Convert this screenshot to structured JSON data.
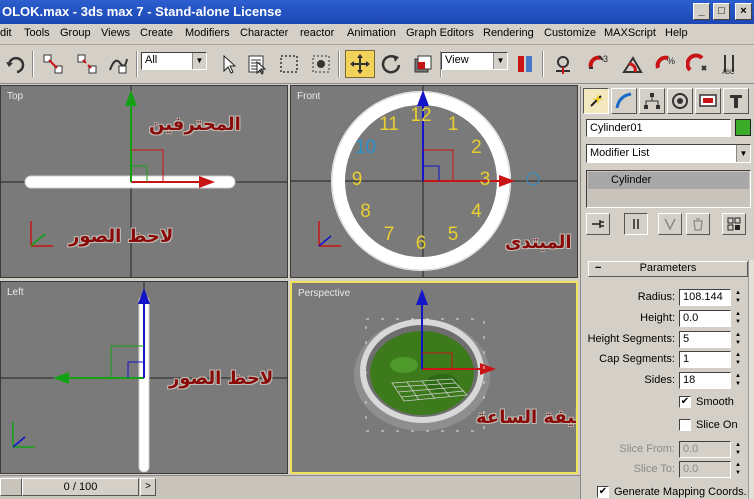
{
  "window": {
    "title": "OLOK.max - 3ds max 7  - Stand-alone License",
    "min": "_",
    "max": "□",
    "close": "×"
  },
  "menu": [
    "dit",
    "Tools",
    "Group",
    "Views",
    "Create",
    "Modifiers",
    "Character",
    "reactor",
    "Animation",
    "Graph Editors",
    "Rendering",
    "Customize",
    "MAXScript",
    "Help"
  ],
  "toolbar": {
    "selection_filter": "All",
    "reference_coord": "View",
    "icons": [
      "undo-icon",
      "select-link-icon",
      "unlink-icon",
      "bind-space-warp-icon",
      "select-object-icon",
      "select-by-name-icon",
      "rect-selection-icon",
      "window-crossing-icon",
      "select-move-icon",
      "select-rotate-icon",
      "select-scale-icon",
      "use-pivot-icon",
      "select-manipulate-icon",
      "snap-3d-icon",
      "angle-snap-icon",
      "percent-snap-icon",
      "spinner-snap-icon",
      "named-selection-icon"
    ]
  },
  "viewports": {
    "top": {
      "label": "Top",
      "note": "المحترفين",
      "note2": "لاحظ الصور"
    },
    "front": {
      "label": "Front",
      "note": "المبتدى",
      "clock_numbers": [
        "12",
        "1",
        "2",
        "3",
        "4",
        "5",
        "6",
        "7",
        "8",
        "9",
        "10",
        "11"
      ]
    },
    "left": {
      "label": "Left",
      "note": "لاحظ الصور"
    },
    "perspective": {
      "label": "Perspective",
      "note": "هذه مقاسات الخليفة الساعة"
    }
  },
  "command_panel": {
    "object_name": "Cylinder01",
    "object_color": "#3cab2a",
    "modifier_list": "Modifier List",
    "stack_item": "Cylinder",
    "rollout_title": "Parameters",
    "rollout_toggle": "−",
    "params": [
      {
        "label": "Radius:",
        "value": "108.144",
        "enabled": true
      },
      {
        "label": "Height:",
        "value": "0.0",
        "enabled": true
      },
      {
        "label": "Height Segments:",
        "value": "5",
        "enabled": true
      },
      {
        "label": "Cap Segments:",
        "value": "1",
        "enabled": true
      },
      {
        "label": "Sides:",
        "value": "18",
        "enabled": true
      }
    ],
    "smooth_label": "Smooth",
    "smooth_checked": true,
    "slice_on_label": "Slice On",
    "slice_on_checked": false,
    "slice_params": [
      {
        "label": "Slice From:",
        "value": "0.0"
      },
      {
        "label": "Slice To:",
        "value": "0.0"
      }
    ],
    "gen_mapping_label": "Generate Mapping Coords.",
    "gen_mapping_checked": true,
    "check_mark": "✔"
  },
  "timeslider": {
    "position": "0 / 100",
    "next": ">"
  },
  "colors": {
    "axis_red": "#c81414",
    "axis_green": "#14a014",
    "axis_blue": "#1414c8",
    "active_border": "#f1e25a",
    "clock_text": "#e8cf30",
    "clock_text_hl": "#2a8ec8"
  }
}
